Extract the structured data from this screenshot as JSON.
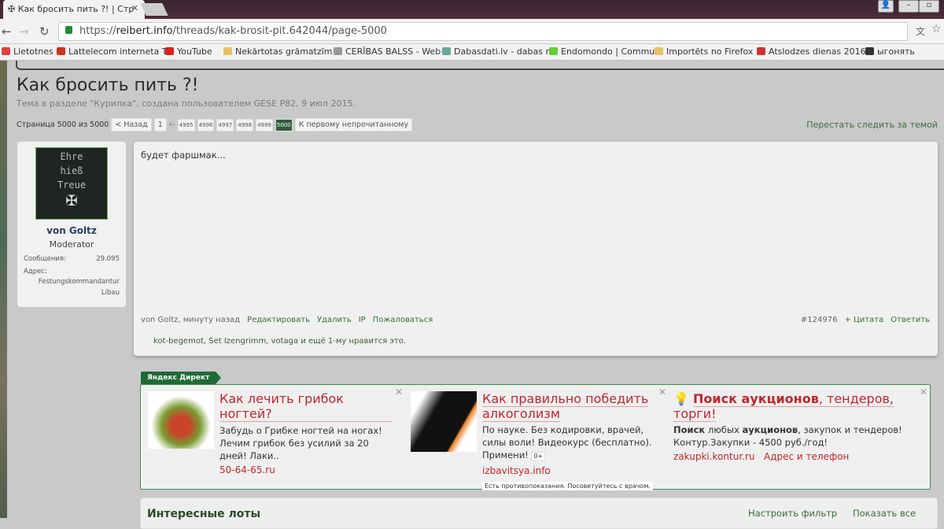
{
  "browser": {
    "tab_title": "Как бросить пить ?! | Стр",
    "url_scheme": "https://",
    "url_host": "reibert.info",
    "url_path": "/threads/kak-brosit-pit.642044/page-5000",
    "bookmarks": [
      "Lietotnes",
      "Lattelecom interneta T",
      "YouTube",
      "Nekārtotas grāmatzīm",
      "CERĪBAS BALSS - Web",
      "Dabasdati.lv - dabas n",
      "Endomondo | Commu",
      "Importēts no Firefox",
      "Atslodzes dienas 2016",
      "ыгонять"
    ]
  },
  "thread": {
    "title": "Как бросить пить ?!",
    "subtitle": "Тема в разделе \"Курилка\", создана пользователем GESE P82, 9 июл 2015.",
    "page_label": "Страница 5000 из 5000",
    "prev": "< Назад",
    "first": "1",
    "ellipsis": "←",
    "pages": [
      "4995",
      "4996",
      "4997",
      "4998",
      "4999"
    ],
    "current": "5000",
    "first_unread": "К первому непрочитанному",
    "unwatch": "Перестать следить за темой"
  },
  "user": {
    "avatar_text": [
      "Ehre",
      "hieß",
      "Treue"
    ],
    "name": "von Goltz",
    "role": "Moderator",
    "posts_label": "Сообщения:",
    "posts": "29.095",
    "address_label": "Адрес:",
    "address1": "Festungskommandantur",
    "address2": "Libau"
  },
  "post": {
    "message": "будет фаршмак...",
    "author_time": "von Goltz, минуту назад",
    "edit": "Редактировать",
    "delete": "Удалить",
    "ip": "IP",
    "report": "Пожаловаться",
    "number": "#124976",
    "quote": "+ Цитата",
    "reply": "Ответить",
    "likes": "kot-begemot, Set Izengrimm, votaga и ещё 1-му нравится это."
  },
  "ads": {
    "tag": "Яндекс Директ",
    "items": [
      {
        "title": "Как лечить грибок ногтей?",
        "text": "Забудь о Грибке ногтей на ногах! Лечим грибок без усилий за 20 дней! Лаки..",
        "url": "50-64-65.ru"
      },
      {
        "title": "Как правильно победить алкоголизм",
        "text": "По науке. Без кодировки, врачей, силы воли! Видеокурс (бесплатно). Примени!",
        "age": "0+",
        "url": "izbavitsya.info",
        "warning": "Есть противопоказания. Посоветуйтесь с врачом."
      },
      {
        "title_bold": "Поиск аукционов",
        "title_rest": ", тендеров, торги!",
        "text_b1": "Поиск",
        "text_1": " любых ",
        "text_b2": "аукционов",
        "text_2": ", закупок и тендеров! Контур.Закупки - 4500 руб./год!",
        "url": "zakupki.kontur.ru",
        "url2": "Адрес и телефон"
      }
    ]
  },
  "lots": {
    "title": "Интересные лоты",
    "filter": "Настроить фильтр",
    "show_all": "Показать все"
  }
}
